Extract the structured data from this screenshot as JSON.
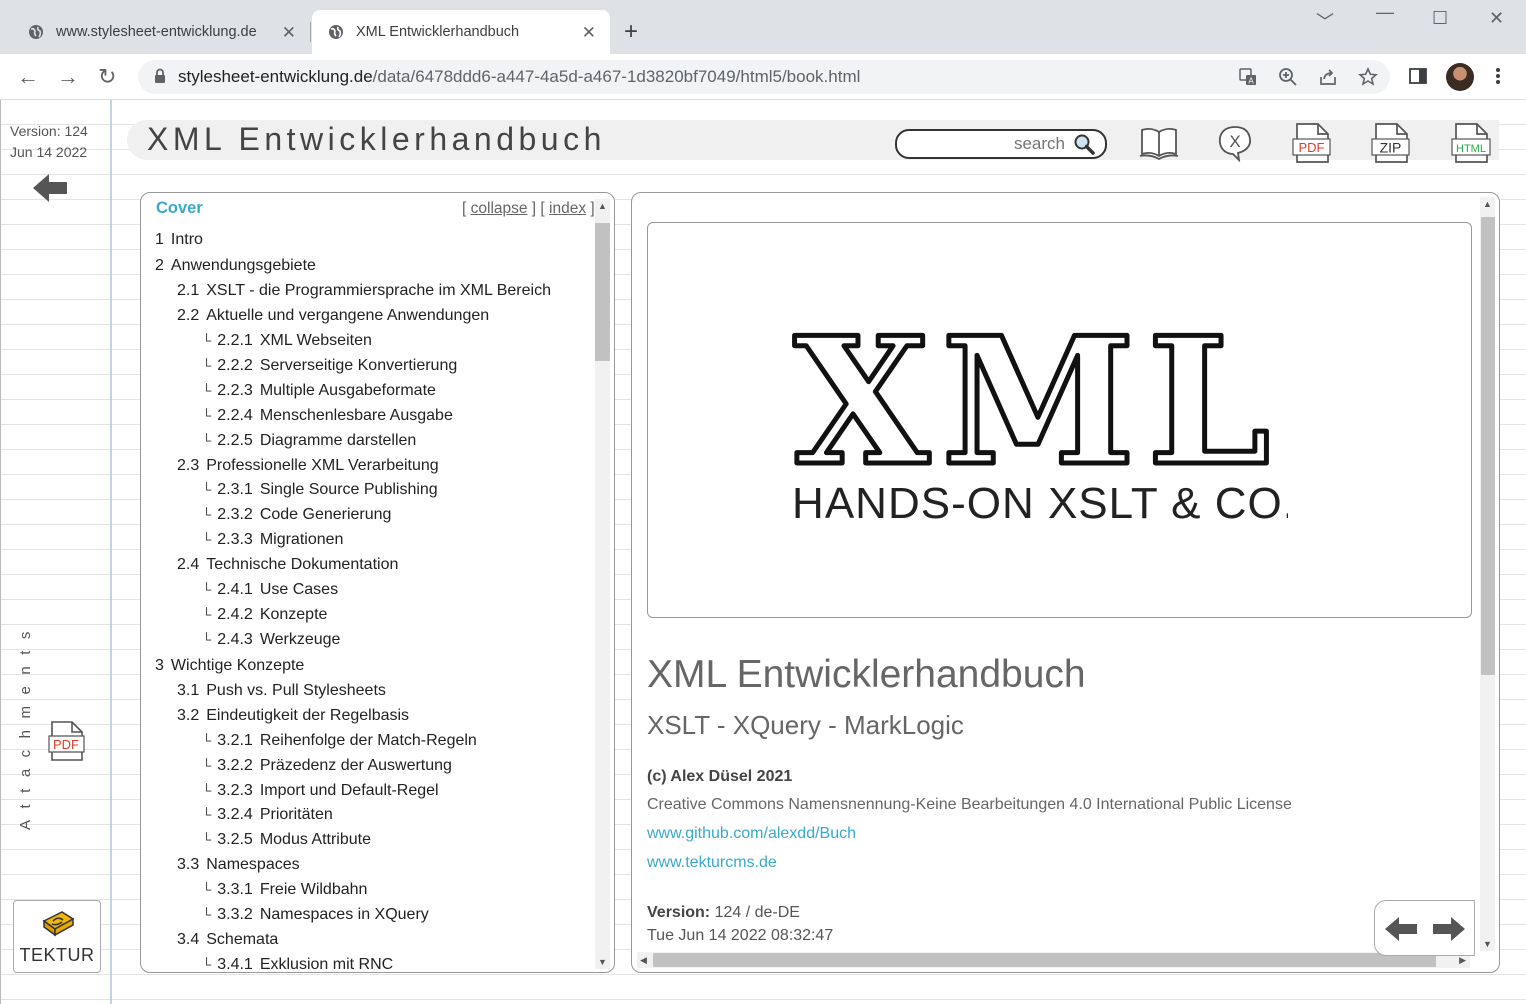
{
  "browser": {
    "tabs": [
      {
        "title": "www.stylesheet-entwicklung.de",
        "active": false
      },
      {
        "title": "XML Entwicklerhandbuch",
        "active": true
      }
    ],
    "url_host": "stylesheet-entwicklung.de",
    "url_path": "/data/6478ddd6-a447-4a5d-a467-1d3820bf7049/html5/book.html"
  },
  "sidebar": {
    "version": "Version: 124",
    "date": "Jun 14 2022",
    "attachments_label": "Attachments",
    "tektur_label": "TEKTUR"
  },
  "header": {
    "title": "XML Entwicklerhandbuch",
    "search_placeholder": "search",
    "icons": [
      "book-icon",
      "xquery-icon",
      "pdf-icon",
      "zip-icon",
      "html-icon"
    ],
    "icon_labels": {
      "xquery": "X",
      "pdf": "PDF",
      "zip": "ZIP",
      "html": "HTML"
    }
  },
  "toc": {
    "cover": "Cover",
    "collapse": "collapse",
    "index": "index",
    "items": [
      {
        "num": "1",
        "title": "Intro",
        "level": 1
      },
      {
        "num": "2",
        "title": "Anwendungsgebiete",
        "level": 1
      },
      {
        "num": "2.1",
        "title": "XSLT - die Programmiersprache im XML Bereich",
        "level": 2
      },
      {
        "num": "2.2",
        "title": "Aktuelle und vergangene Anwendungen",
        "level": 2
      },
      {
        "num": "2.2.1",
        "title": "XML Webseiten",
        "level": 3
      },
      {
        "num": "2.2.2",
        "title": "Serverseitige Konvertierung",
        "level": 3
      },
      {
        "num": "2.2.3",
        "title": "Multiple Ausgabeformate",
        "level": 3
      },
      {
        "num": "2.2.4",
        "title": "Menschenlesbare Ausgabe",
        "level": 3
      },
      {
        "num": "2.2.5",
        "title": "Diagramme darstellen",
        "level": 3
      },
      {
        "num": "2.3",
        "title": "Professionelle XML Verarbeitung",
        "level": 2
      },
      {
        "num": "2.3.1",
        "title": "Single Source Publishing",
        "level": 3
      },
      {
        "num": "2.3.2",
        "title": "Code Generierung",
        "level": 3
      },
      {
        "num": "2.3.3",
        "title": "Migrationen",
        "level": 3
      },
      {
        "num": "2.4",
        "title": "Technische Dokumentation",
        "level": 2
      },
      {
        "num": "2.4.1",
        "title": "Use Cases",
        "level": 3
      },
      {
        "num": "2.4.2",
        "title": "Konzepte",
        "level": 3
      },
      {
        "num": "2.4.3",
        "title": "Werkzeuge",
        "level": 3
      },
      {
        "num": "3",
        "title": "Wichtige Konzepte",
        "level": 1
      },
      {
        "num": "3.1",
        "title": "Push vs. Pull Stylesheets",
        "level": 2
      },
      {
        "num": "3.2",
        "title": "Eindeutigkeit der Regelbasis",
        "level": 2
      },
      {
        "num": "3.2.1",
        "title": "Reihenfolge der Match-Regeln",
        "level": 3
      },
      {
        "num": "3.2.2",
        "title": "Präzedenz der Auswertung",
        "level": 3
      },
      {
        "num": "3.2.3",
        "title": "Import und Default-Regel",
        "level": 3
      },
      {
        "num": "3.2.4",
        "title": "Prioritäten",
        "level": 3
      },
      {
        "num": "3.2.5",
        "title": "Modus Attribute",
        "level": 3
      },
      {
        "num": "3.3",
        "title": "Namespaces",
        "level": 2
      },
      {
        "num": "3.3.1",
        "title": "Freie Wildbahn",
        "level": 3
      },
      {
        "num": "3.3.2",
        "title": "Namespaces in XQuery",
        "level": 3
      },
      {
        "num": "3.4",
        "title": "Schemata",
        "level": 2
      },
      {
        "num": "3.4.1",
        "title": "Exklusion mit RNC",
        "level": 3
      }
    ]
  },
  "content": {
    "logo_main": "XML",
    "logo_sub": "HANDS-ON XSLT & CO.",
    "title": "XML Entwicklerhandbuch",
    "subtitle": "XSLT - XQuery - MarkLogic",
    "copyright": "(c) Alex Düsel 2021",
    "license": "Creative Commons Namensnennung-Keine Bearbeitungen 4.0 International Public License",
    "link1": "www.github.com/alexdd/Buch",
    "link2": "www.tekturcms.de",
    "version_label": "Version:",
    "version_value": "124 / de-DE",
    "date": "Tue Jun 14 2022 08:32:47"
  }
}
